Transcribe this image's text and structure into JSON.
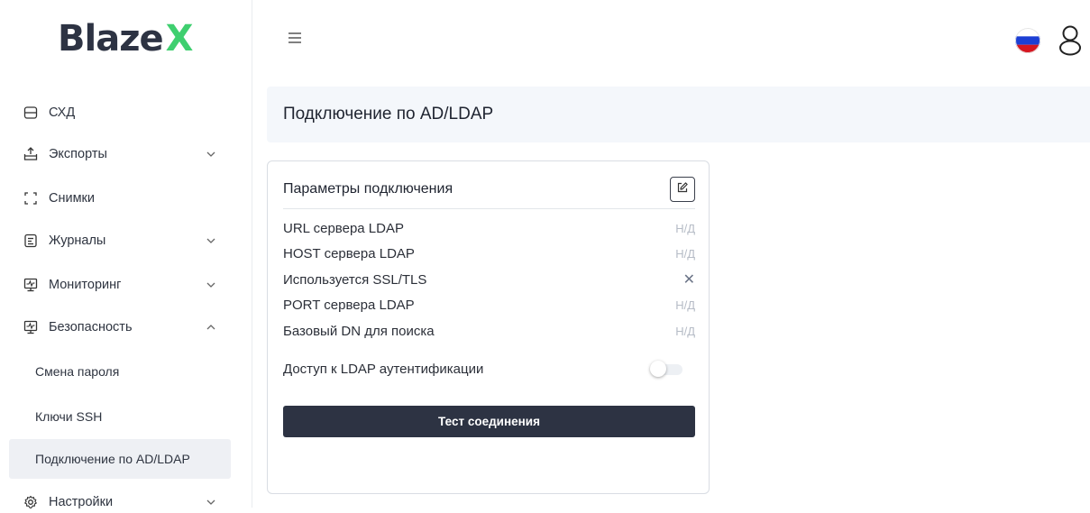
{
  "app": {
    "logo_text": "Blaze",
    "logo_accent": "X",
    "brand_color": "#2d3343",
    "accent_color": "#3fcf6f"
  },
  "sidebar": {
    "items": [
      {
        "label": "СХД",
        "icon": "storage-icon",
        "expandable": false
      },
      {
        "label": "Экспорты",
        "icon": "export-icon",
        "expandable": true,
        "expanded": false
      },
      {
        "label": "Снимки",
        "icon": "snapshot-icon",
        "expandable": false
      },
      {
        "label": "Журналы",
        "icon": "journal-icon",
        "expandable": true,
        "expanded": false
      },
      {
        "label": "Мониторинг",
        "icon": "monitor-icon",
        "expandable": true,
        "expanded": false
      },
      {
        "label": "Безопасность",
        "icon": "monitor-icon",
        "expandable": true,
        "expanded": true
      },
      {
        "label": "Настройки",
        "icon": "gear-icon",
        "expandable": true,
        "expanded": false
      }
    ],
    "security_sub": [
      {
        "label": "Смена пароля",
        "active": false
      },
      {
        "label": "Ключи SSH",
        "active": false
      },
      {
        "label": "Подключение по AD/LDAP",
        "active": true
      }
    ]
  },
  "header": {
    "menu_icon": "hamburger-icon",
    "flag_icon": "russia-flag-icon",
    "user_icon": "user-icon"
  },
  "page": {
    "title": "Подключение по AD/LDAP"
  },
  "card": {
    "title": "Параметры подключения",
    "rows": [
      {
        "label": "URL сервера LDAP",
        "value": "Н/Д"
      },
      {
        "label": "HOST сервера LDAP",
        "value": "Н/Д"
      },
      {
        "label": "Используется SSL/TLS",
        "value": "✕"
      },
      {
        "label": "PORT сервера LDAP",
        "value": "Н/Д"
      },
      {
        "label": "Базовый DN для поиска",
        "value": "Н/Д"
      }
    ],
    "toggle_label": "Доступ к LDAP аутентификации",
    "toggle_on": false,
    "test_button": "Тест соединения"
  }
}
